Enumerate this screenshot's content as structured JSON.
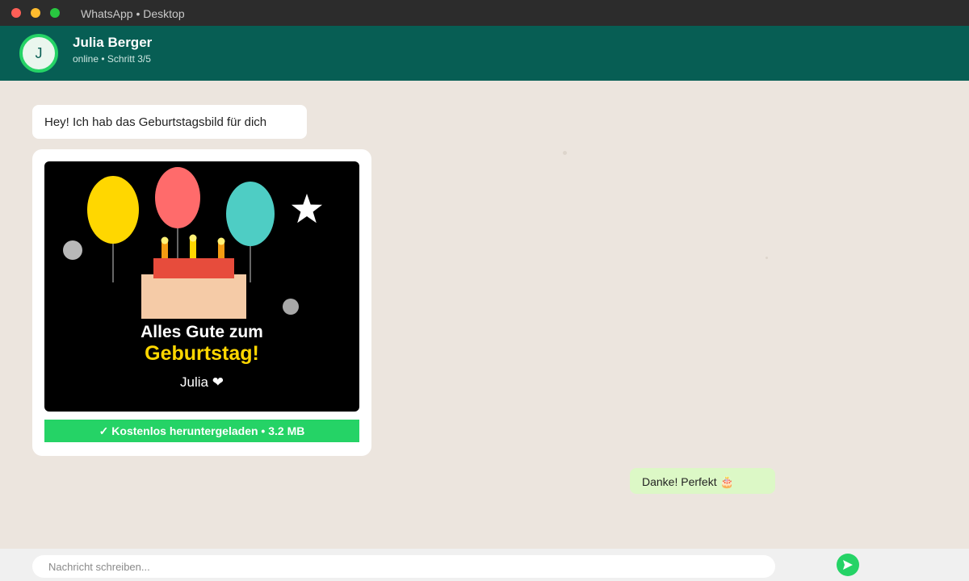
{
  "window": {
    "title": "WhatsApp • Desktop"
  },
  "header": {
    "avatar_initial": "J",
    "contact_name": "Julia Berger",
    "contact_status": "online • Schritt 3/5"
  },
  "messages": [
    {
      "direction": "incoming",
      "type": "text",
      "text": "Hey! Ich hab das Geburtstagsbild für dich"
    },
    {
      "direction": "incoming",
      "type": "image",
      "card": {
        "line1": "Alles Gute zum",
        "line2": "Geburtstag!",
        "signature": "Julia ❤"
      },
      "download_status": "✓ Kostenlos heruntergeladen • 3.2 MB"
    },
    {
      "direction": "outgoing",
      "type": "text",
      "text": "Danke! Perfekt 🎂"
    }
  ],
  "composer": {
    "placeholder": "Nachricht schreiben...",
    "send_icon": "send-icon"
  },
  "colors": {
    "header": "#075e54",
    "accent": "#25d366",
    "chat_background": "#ece5de",
    "outgoing_bubble": "#dcf8c6",
    "balloon_yellow": "#ffd700",
    "balloon_red": "#ff6b6b",
    "balloon_teal": "#4ecdc4"
  }
}
